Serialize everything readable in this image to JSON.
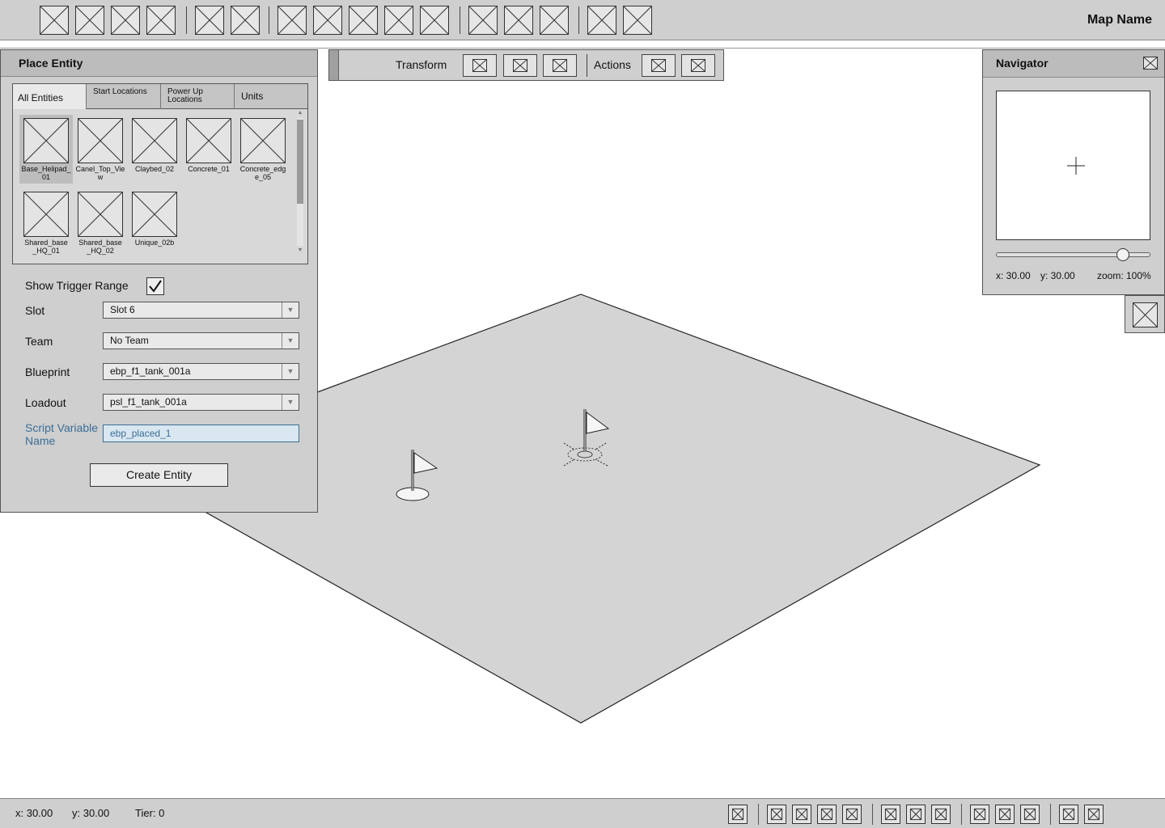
{
  "header": {
    "map_name": "Map Name"
  },
  "place_entity": {
    "title": "Place Entity",
    "tabs": [
      {
        "label": "All Entities"
      },
      {
        "label": "Start Locations"
      },
      {
        "label": "Power Up Locations"
      },
      {
        "label": "Units"
      }
    ],
    "entities": [
      {
        "name": "Base_Helipad_01",
        "selected": true
      },
      {
        "name": "Canel_Top_View"
      },
      {
        "name": "Claybed_02"
      },
      {
        "name": "Concrete_01"
      },
      {
        "name": "Concrete_edge_05"
      },
      {
        "name": "Shared_base_HQ_01"
      },
      {
        "name": "Shared_base_HQ_02"
      },
      {
        "name": "Unique_02b"
      }
    ],
    "show_trigger_range": {
      "label": "Show Trigger Range",
      "checked": true
    },
    "slot": {
      "label": "Slot",
      "value": "Slot 6"
    },
    "team": {
      "label": "Team",
      "value": "No Team"
    },
    "blueprint": {
      "label": "Blueprint",
      "value": "ebp_f1_tank_001a"
    },
    "loadout": {
      "label": "Loadout",
      "value": "psl_f1_tank_001a"
    },
    "script_variable": {
      "label": "Script Variable Name",
      "value": "ebp_placed_1"
    },
    "create_button": "Create Entity"
  },
  "transform_toolbar": {
    "transform_label": "Transform",
    "actions_label": "Actions"
  },
  "navigator": {
    "title": "Navigator",
    "x": "x:  30.00",
    "y": "y:  30.00",
    "zoom": "zoom:  100%",
    "zoom_level": 0.85
  },
  "status_bar": {
    "x": "x: 30.00",
    "y": "y: 30.00",
    "tier": "Tier: 0"
  },
  "colors": {
    "panel": "#cfcfcf",
    "header": "#bcbcbc",
    "accent": "#3b6e96",
    "ground": "#d4d4d4"
  },
  "icons": {
    "placeholder": "image-placeholder-icon",
    "flag": "flag-icon",
    "selected_flag": "selected-flag-icon",
    "checkmark": "checkmark-icon",
    "crosshair": "crosshair-icon",
    "close": "close-icon"
  }
}
